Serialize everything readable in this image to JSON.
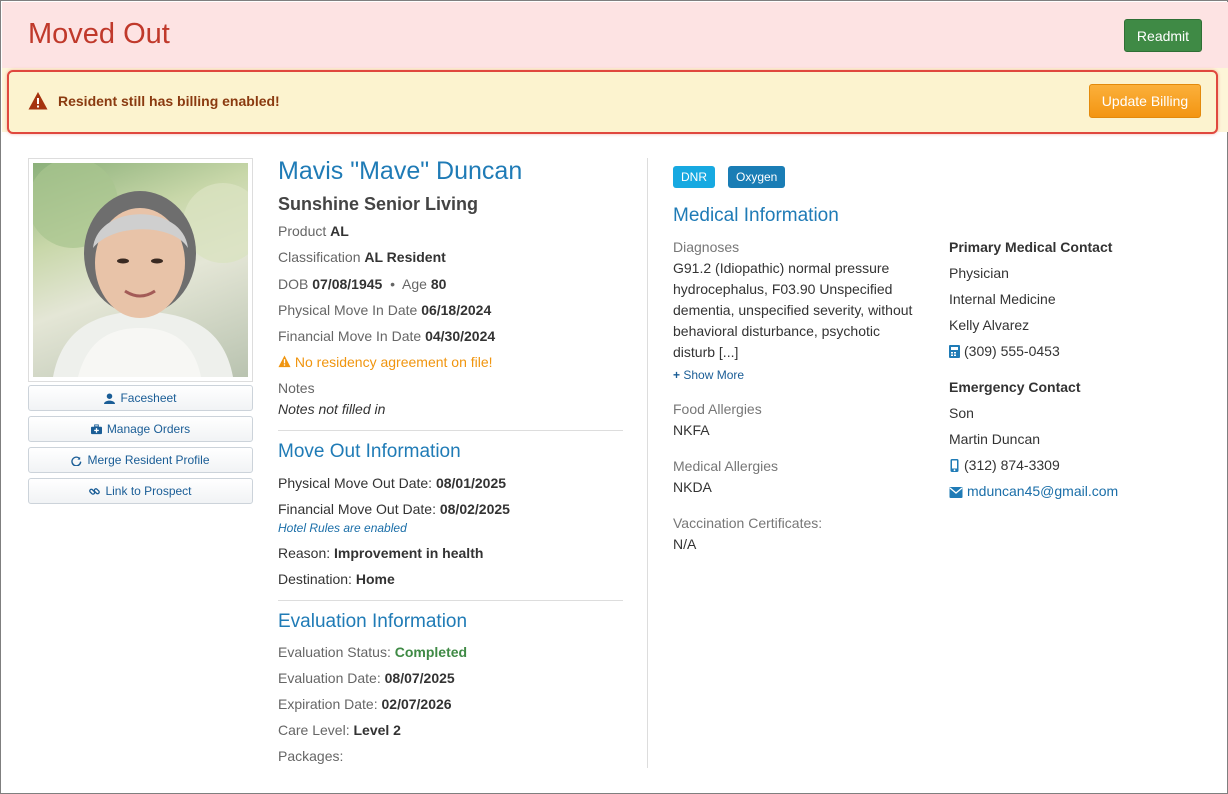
{
  "header": {
    "title": "Moved Out",
    "readmit_label": "Readmit"
  },
  "alert": {
    "text": "Resident still has billing enabled!",
    "button_label": "Update Billing"
  },
  "side_buttons": [
    {
      "label": "Facesheet",
      "icon": "user-icon"
    },
    {
      "label": "Manage Orders",
      "icon": "briefcase-medical-icon"
    },
    {
      "label": "Merge Resident Profile",
      "icon": "refresh-icon"
    },
    {
      "label": "Link to Prospect",
      "icon": "link-icon"
    }
  ],
  "resident": {
    "name": "Mavis \"Mave\" Duncan",
    "facility": "Sunshine Senior Living",
    "product_label": "Product",
    "product": "AL",
    "classification_label": "Classification",
    "classification": "AL Resident",
    "dob_label": "DOB",
    "dob": "07/08/1945",
    "bullet": "•",
    "age_label": "Age",
    "age": "80",
    "physical_move_in_label": "Physical Move In Date",
    "physical_move_in": "06/18/2024",
    "financial_move_in_label": "Financial Move In Date",
    "financial_move_in": "04/30/2024",
    "residency_warning": "No residency agreement on file!",
    "notes_label": "Notes",
    "notes_value": "Notes not filled in"
  },
  "move_out": {
    "title": "Move Out Information",
    "physical_label": "Physical Move Out Date:",
    "physical": "08/01/2025",
    "financial_label": "Financial Move Out Date:",
    "financial": "08/02/2025",
    "hotel_rules": "Hotel Rules are enabled",
    "reason_label": "Reason:",
    "reason": "Improvement in health",
    "destination_label": "Destination:",
    "destination": "Home"
  },
  "evaluation": {
    "title": "Evaluation Information",
    "status_label": "Evaluation Status:",
    "status": "Completed",
    "date_label": "Evaluation Date:",
    "date": "08/07/2025",
    "expiration_label": "Expiration Date:",
    "expiration": "02/07/2026",
    "care_level_label": "Care Level:",
    "care_level": "Level 2",
    "packages_label": "Packages:"
  },
  "badges": [
    {
      "label": "DNR",
      "color": "#17a9e1"
    },
    {
      "label": "Oxygen",
      "color": "#1a7db5"
    }
  ],
  "medical": {
    "title": "Medical Information",
    "diagnoses_label": "Diagnoses",
    "diagnoses": "G91.2 (Idiopathic) normal pressure hydrocephalus, F03.90 Unspecified dementia, unspecified severity, without behavioral disturbance, psychotic disturb [...]",
    "show_more": "Show More",
    "food_allergies_label": "Food Allergies",
    "food_allergies": "NKFA",
    "medical_allergies_label": "Medical Allergies",
    "medical_allergies": "NKDA",
    "vaccination_label": "Vaccination Certificates:",
    "vaccination": "N/A"
  },
  "primary_contact": {
    "heading": "Primary Medical Contact",
    "role": "Physician",
    "specialty": "Internal Medicine",
    "name": "Kelly Alvarez",
    "phone": "(309) 555-0453"
  },
  "emergency_contact": {
    "heading": "Emergency Contact",
    "relation": "Son",
    "name": "Martin Duncan",
    "phone": "(312) 874-3309",
    "email": "mduncan45@gmail.com"
  },
  "colors": {
    "accent": "#1f7bb6",
    "danger": "#c0392b",
    "success": "#3f8a45",
    "warning": "#f39512"
  }
}
